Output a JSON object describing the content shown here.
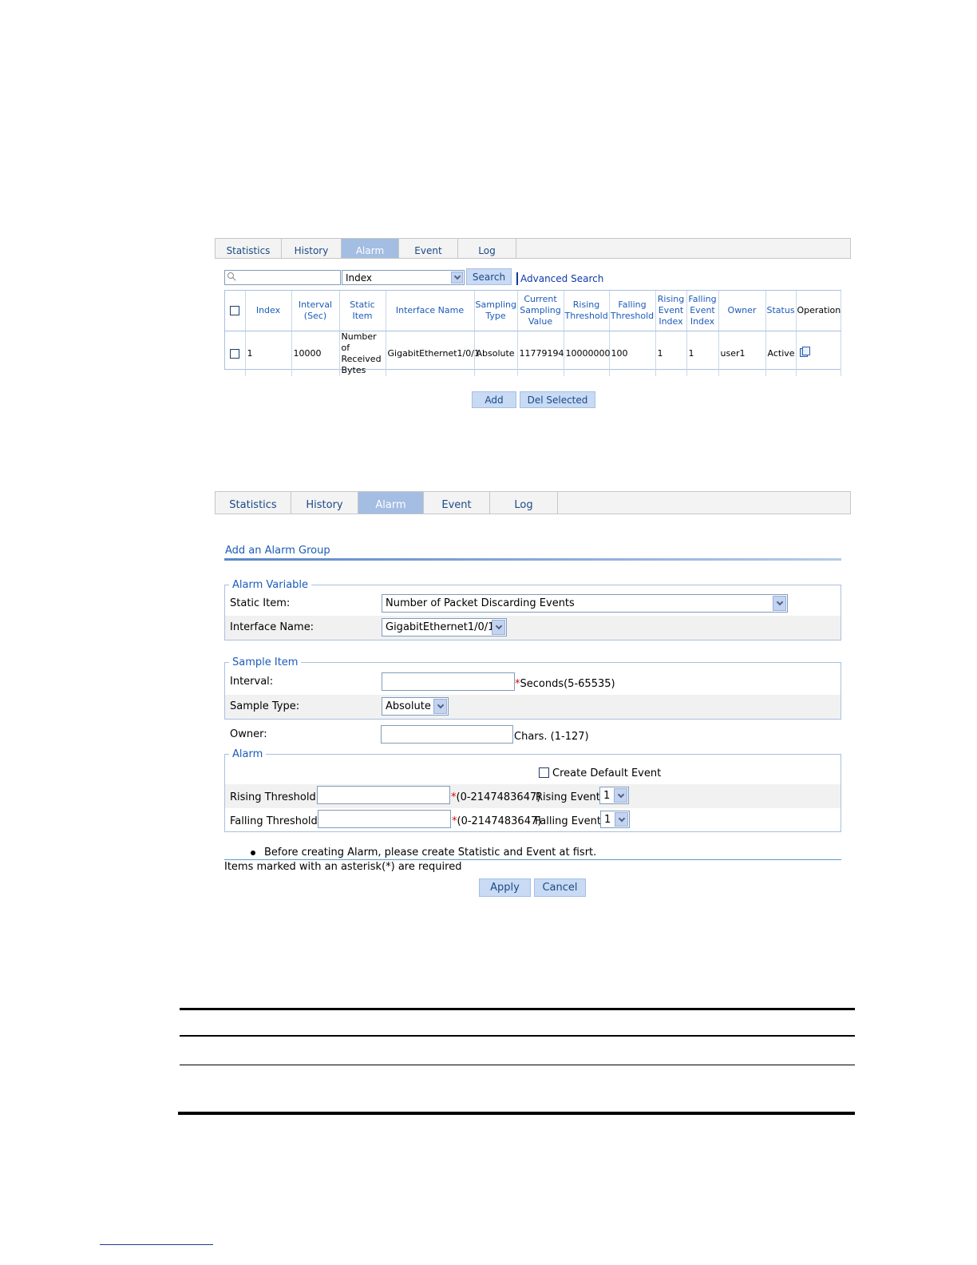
{
  "list_page": {
    "tabs": [
      "Statistics",
      "History",
      "Alarm",
      "Event",
      "Log"
    ],
    "active_tab": "Alarm",
    "search": {
      "value": "",
      "field": "Index",
      "button": "Search",
      "advanced": "Advanced Search"
    },
    "columns": [
      "Index",
      "Interval (Sec)",
      "Static Item",
      "Interface Name",
      "Sampling Type",
      "Current Sampling Value",
      "Rising Threshold",
      "Falling Threshold",
      "Rising Event Index",
      "Falling Event Index",
      "Owner",
      "Status",
      "Operation"
    ],
    "rows": [
      {
        "index": "1",
        "interval": "10000",
        "static_item": "Number of Received Bytes",
        "interface": "GigabitEthernet1/0/1",
        "sampling_type": "Absolute",
        "current_value": "11779194",
        "rising": "10000000",
        "falling": "100",
        "rising_event": "1",
        "falling_event": "1",
        "owner": "user1",
        "status": "Active"
      }
    ],
    "buttons": {
      "add": "Add",
      "del_selected": "Del Selected"
    }
  },
  "add_page": {
    "tabs": [
      "Statistics",
      "History",
      "Alarm",
      "Event",
      "Log"
    ],
    "active_tab": "Alarm",
    "title": "Add an Alarm Group",
    "alarm_variable": {
      "legend": "Alarm Variable",
      "static_item_label": "Static Item:",
      "static_item_value": "Number of Packet Discarding Events",
      "interface_label": "Interface Name:",
      "interface_value": "GigabitEthernet1/0/1"
    },
    "sample_item": {
      "legend": "Sample Item",
      "interval_label": "Interval:",
      "interval_value": "",
      "interval_hint": "Seconds(5-65535)",
      "sample_type_label": "Sample Type:",
      "sample_type_value": "Absolute"
    },
    "owner": {
      "label": "Owner:",
      "value": "",
      "hint": "Chars. (1-127)"
    },
    "alarm": {
      "legend": "Alarm",
      "create_default_event": "Create Default Event",
      "rising_threshold_label": "Rising Threshold:",
      "rising_hint": "(0-2147483647)",
      "rising_event_label": "Rising Event:",
      "rising_event_value": "1",
      "falling_threshold_label": "Falling Threshold:",
      "falling_hint": "(0-2147483647)",
      "falling_event_label": "Falling Event:",
      "falling_event_value": "1"
    },
    "note": "Before creating Alarm, please create Statistic and Event at fisrt.",
    "required_note": "Items marked with an asterisk(*) are required",
    "buttons": {
      "apply": "Apply",
      "cancel": "Cancel"
    },
    "asterisk": "*"
  }
}
